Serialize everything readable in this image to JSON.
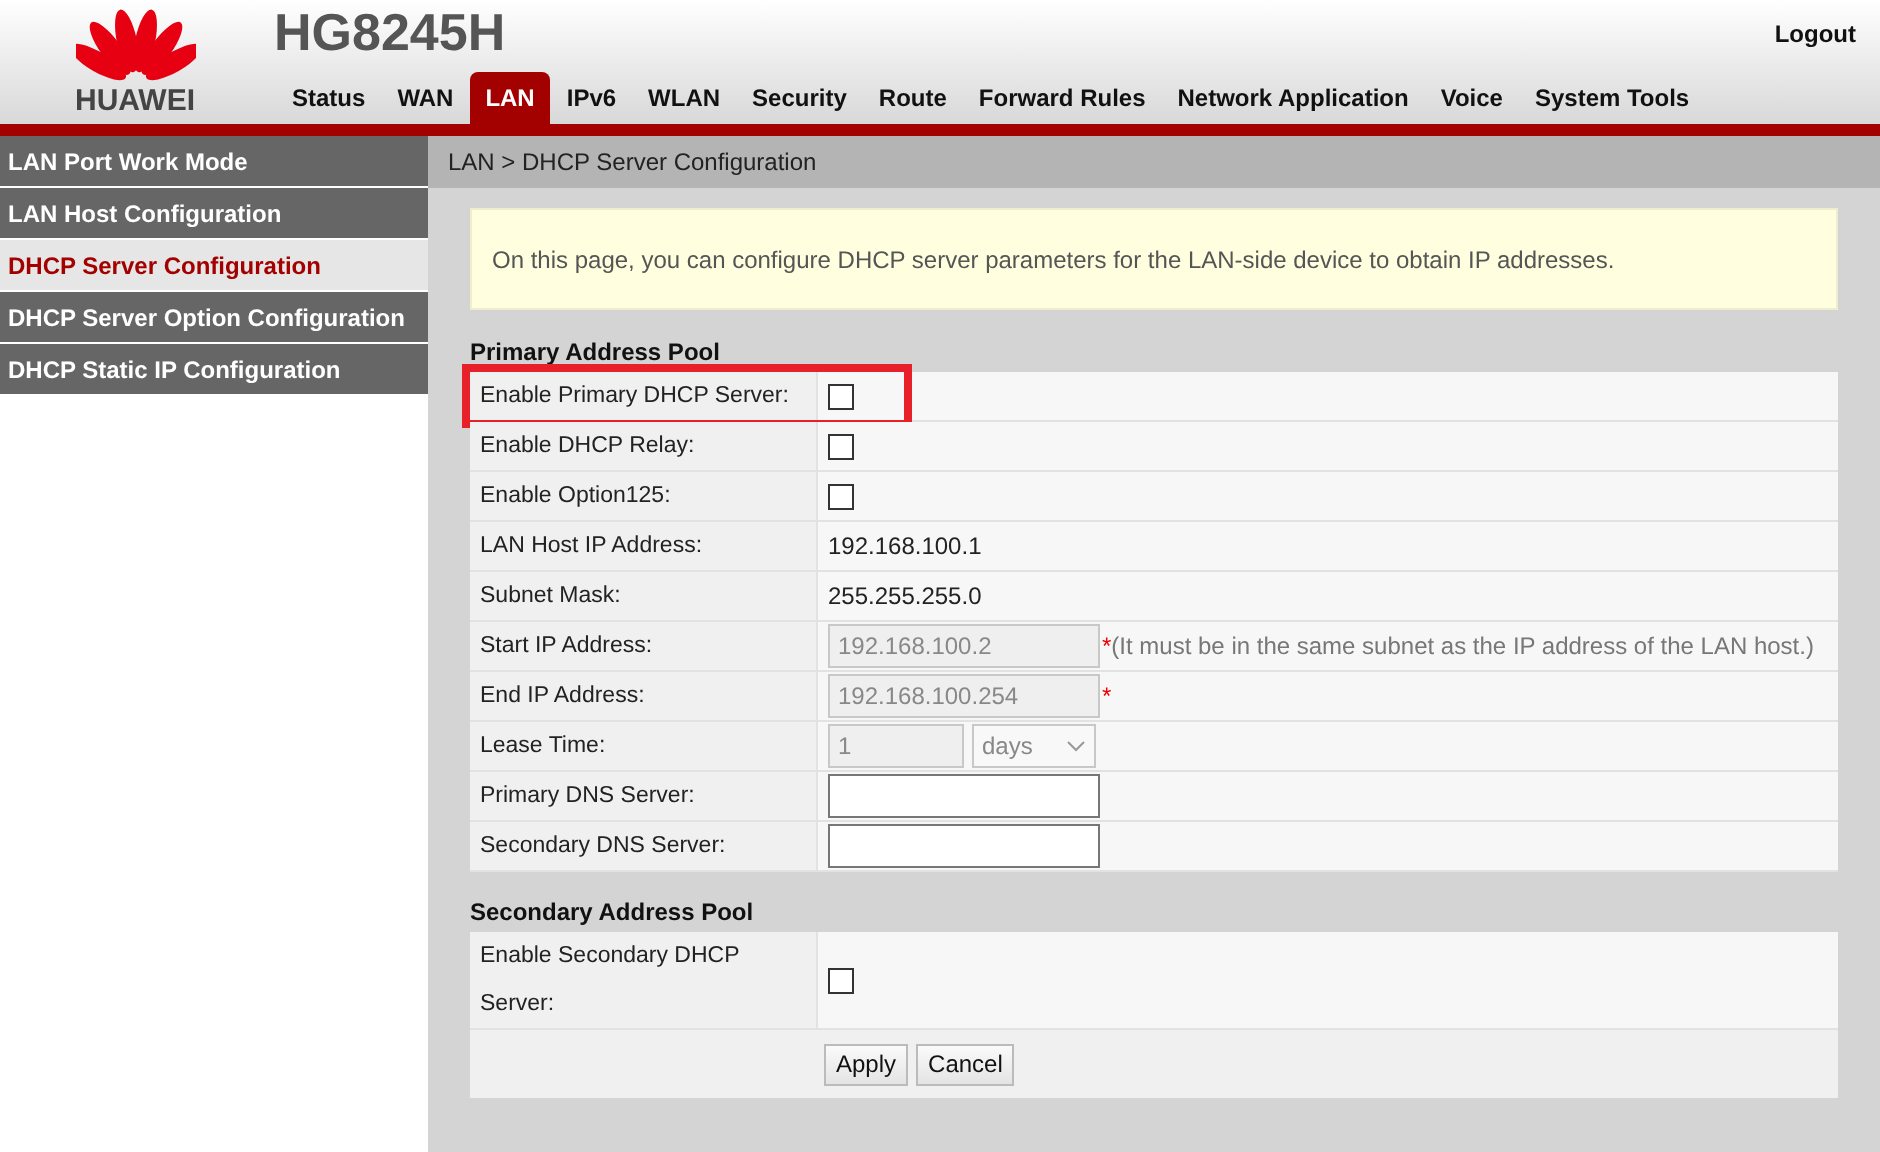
{
  "header": {
    "brand": "HUAWEI",
    "model": "HG8245H",
    "logout": "Logout"
  },
  "tabs": [
    {
      "label": "Status",
      "selected": false
    },
    {
      "label": "WAN",
      "selected": false
    },
    {
      "label": "LAN",
      "selected": true
    },
    {
      "label": "IPv6",
      "selected": false
    },
    {
      "label": "WLAN",
      "selected": false
    },
    {
      "label": "Security",
      "selected": false
    },
    {
      "label": "Route",
      "selected": false
    },
    {
      "label": "Forward Rules",
      "selected": false
    },
    {
      "label": "Network Application",
      "selected": false
    },
    {
      "label": "Voice",
      "selected": false
    },
    {
      "label": "System Tools",
      "selected": false
    }
  ],
  "sidebar": {
    "items": [
      {
        "label": "LAN Port Work Mode",
        "selected": false
      },
      {
        "label": "LAN Host Configuration",
        "selected": false
      },
      {
        "label": "DHCP Server Configuration",
        "selected": true
      },
      {
        "label": "DHCP Server Option Configuration",
        "selected": false
      },
      {
        "label": "DHCP Static IP Configuration",
        "selected": false
      }
    ]
  },
  "breadcrumb": "LAN > DHCP Server Configuration",
  "info": "On this page, you can configure DHCP server parameters for the LAN-side device to obtain IP addresses.",
  "sections": [
    {
      "title": "Primary Address Pool",
      "rows": [
        {
          "label": "Enable Primary DHCP Server:",
          "kind": "checkbox",
          "checked": false,
          "highlighted": true
        },
        {
          "label": "Enable DHCP Relay:",
          "kind": "checkbox",
          "checked": false,
          "highlighted": false
        },
        {
          "label": "Enable Option125:",
          "kind": "checkbox",
          "checked": false,
          "highlighted": false
        },
        {
          "label": "LAN Host IP Address:",
          "kind": "text",
          "value": "192.168.100.1",
          "highlighted": false
        },
        {
          "label": "Subnet Mask:",
          "kind": "text",
          "value": "255.255.255.0",
          "highlighted": false
        },
        {
          "label": "Start IP Address:",
          "kind": "input",
          "value": "192.168.100.2",
          "disabled": true,
          "required_mark": "*",
          "note": "(It must be in the same subnet as the IP address of the LAN host.)",
          "highlighted": false
        },
        {
          "label": "End IP Address:",
          "kind": "input",
          "value": "192.168.100.254",
          "disabled": true,
          "required_mark": "*",
          "highlighted": false
        },
        {
          "label": "Lease Time:",
          "kind": "lease",
          "value": "1",
          "unit": "days",
          "disabled": true,
          "highlighted": false
        },
        {
          "label": "Primary DNS Server:",
          "kind": "input",
          "disabled": false,
          "highlighted": false
        },
        {
          "label": "Secondary DNS Server:",
          "kind": "input",
          "disabled": false,
          "highlighted": false
        }
      ]
    },
    {
      "title": "Secondary Address Pool",
      "rows": [
        {
          "label": "Enable Secondary DHCP Server:",
          "kind": "checkbox",
          "checked": false,
          "highlighted": false
        }
      ]
    }
  ],
  "buttons": [
    "Apply",
    "Cancel"
  ]
}
